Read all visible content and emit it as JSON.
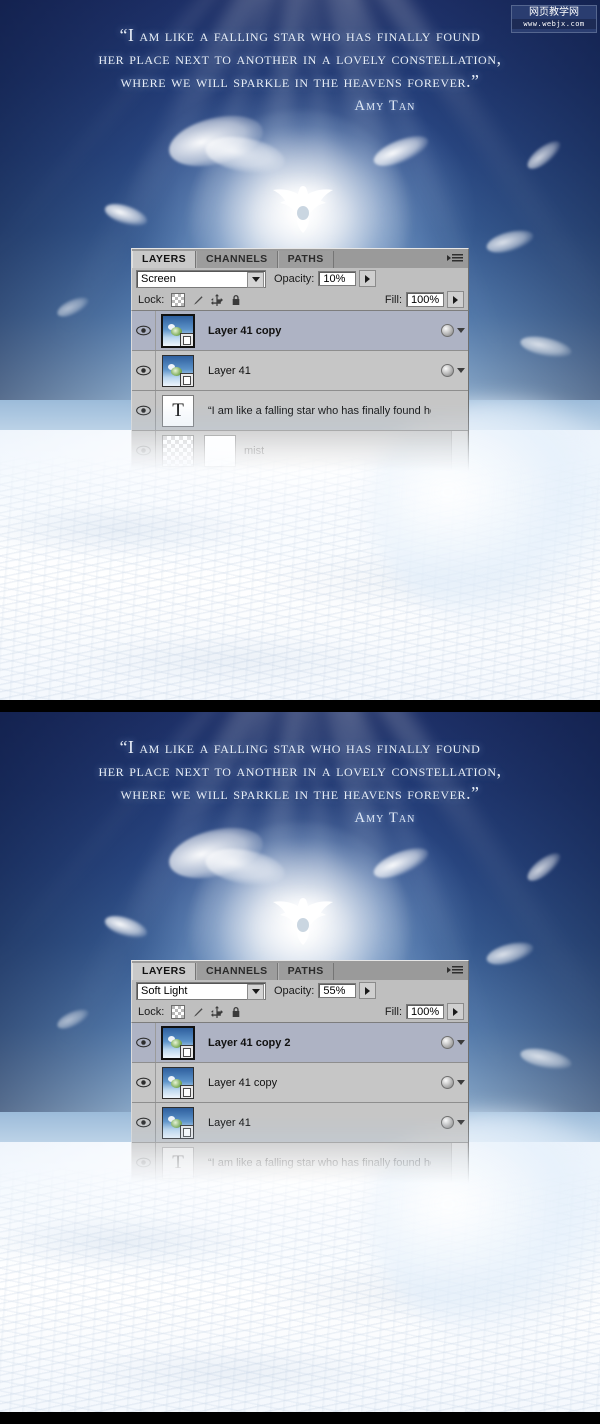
{
  "artwork": {
    "quote_lines": [
      "“I am like a falling star who has finally found",
      "her place next to another in a lovely  constellation,",
      "where we will sparkle in the heavens forever.”"
    ],
    "author": "Amy Tan",
    "watermark": {
      "cn": "网页教学网",
      "en": "www.webjx.com"
    },
    "colors": {
      "sky_deep": "#1d2f66",
      "sky_mid": "#3a6099",
      "sky_light": "#cfe0ef",
      "snow": "#ffffff",
      "quote_text": "#e8eef8",
      "panel_bg": "#c6c6c6",
      "panel_selected": "#aeb3c4"
    }
  },
  "panels": [
    {
      "id": "panel-top",
      "tabs": [
        {
          "label": "LAYERS",
          "active": true
        },
        {
          "label": "CHANNELS",
          "active": false
        },
        {
          "label": "PATHS",
          "active": false
        }
      ],
      "blend_mode": "Screen",
      "opacity_label": "Opacity:",
      "opacity_value": "10%",
      "lock_label": "Lock:",
      "fill_label": "Fill:",
      "fill_value": "100%",
      "lock_icons": [
        "lock-transparent-pixels",
        "lock-image-pixels",
        "lock-position",
        "lock-all"
      ],
      "layers": [
        {
          "name": "Layer 41 copy",
          "type": "smart-object",
          "selected": true,
          "visible": true,
          "ghost": false,
          "has_fx": true
        },
        {
          "name": "Layer 41",
          "type": "smart-object",
          "selected": false,
          "visible": true,
          "ghost": false,
          "has_fx": true
        },
        {
          "name": "“I am like a falling star who has finally found   her pl...",
          "type": "text",
          "selected": false,
          "visible": true,
          "ghost": false,
          "has_fx": false
        },
        {
          "name": "mist",
          "type": "masked",
          "selected": false,
          "visible": false,
          "ghost": true,
          "has_fx": false
        }
      ]
    },
    {
      "id": "panel-bottom",
      "tabs": [
        {
          "label": "LAYERS",
          "active": true
        },
        {
          "label": "CHANNELS",
          "active": false
        },
        {
          "label": "PATHS",
          "active": false
        }
      ],
      "blend_mode": "Soft Light",
      "opacity_label": "Opacity:",
      "opacity_value": "55%",
      "lock_label": "Lock:",
      "fill_label": "Fill:",
      "fill_value": "100%",
      "lock_icons": [
        "lock-transparent-pixels",
        "lock-image-pixels",
        "lock-position",
        "lock-all"
      ],
      "layers": [
        {
          "name": "Layer 41 copy 2",
          "type": "smart-object",
          "selected": true,
          "visible": true,
          "ghost": false,
          "has_fx": true
        },
        {
          "name": "Layer 41 copy",
          "type": "smart-object",
          "selected": false,
          "visible": true,
          "ghost": false,
          "has_fx": true
        },
        {
          "name": "Layer 41",
          "type": "smart-object",
          "selected": false,
          "visible": true,
          "ghost": false,
          "has_fx": true
        },
        {
          "name": "“I am like a falling star who has finally found   her pl...",
          "type": "text",
          "selected": false,
          "visible": false,
          "ghost": true,
          "has_fx": false
        }
      ]
    }
  ]
}
